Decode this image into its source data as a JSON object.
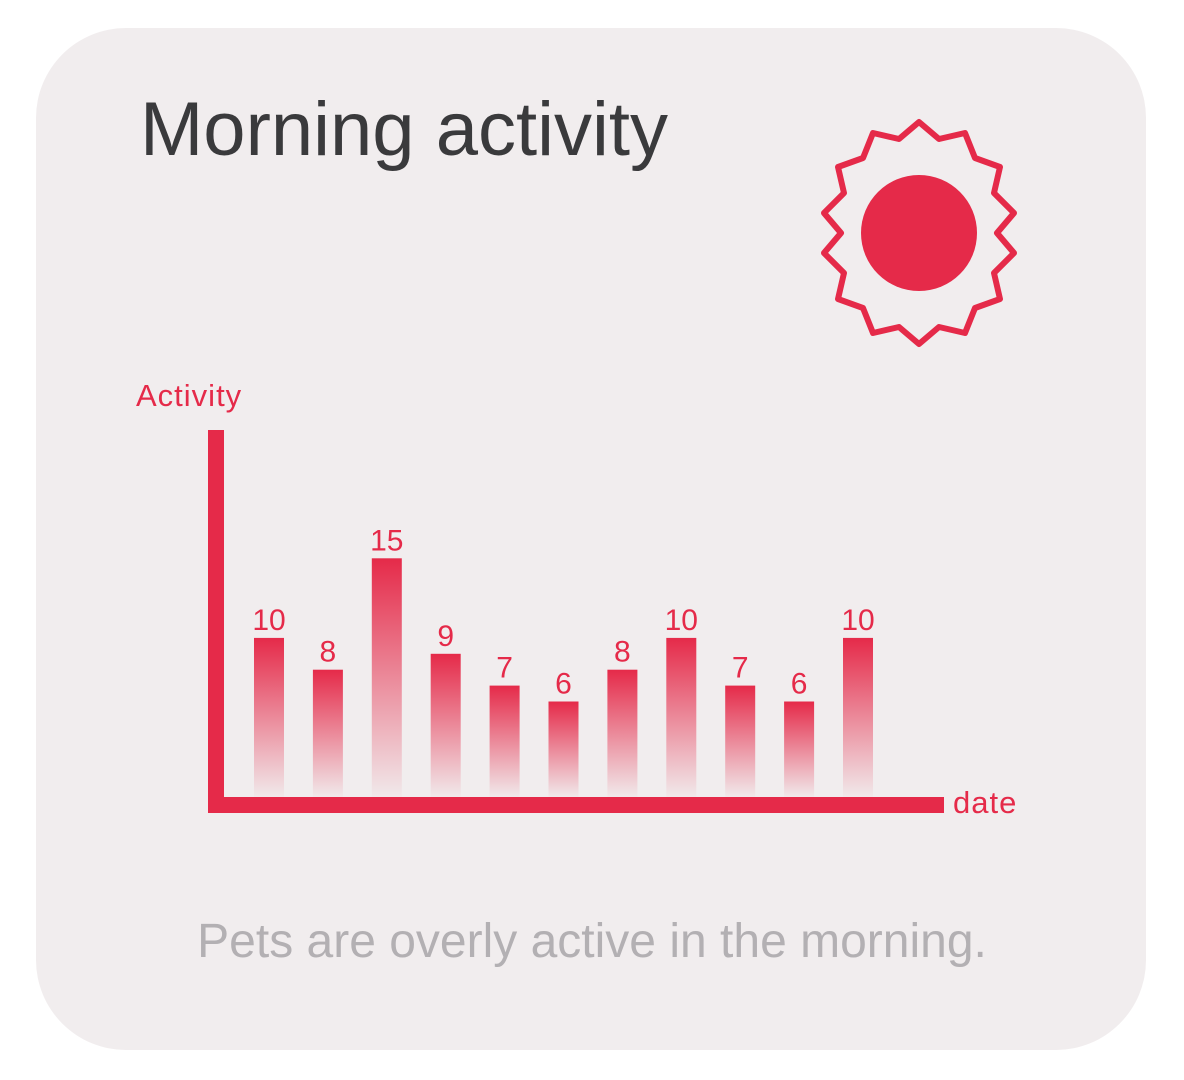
{
  "card": {
    "title": "Morning activity",
    "caption": "Pets are overly active in the morning.",
    "icon": "sun-icon"
  },
  "colors": {
    "accent": "#e52a49",
    "title": "#3a3a3c",
    "caption": "#b3b0b3",
    "card_background": "#f1edee"
  },
  "chart_data": {
    "type": "bar",
    "ylabel": "Activity",
    "xlabel": "date",
    "ylim": [
      0,
      23
    ],
    "grid": false,
    "legend": "none",
    "values": [
      10,
      8,
      15,
      9,
      7,
      6,
      8,
      10,
      7,
      6,
      10
    ]
  }
}
